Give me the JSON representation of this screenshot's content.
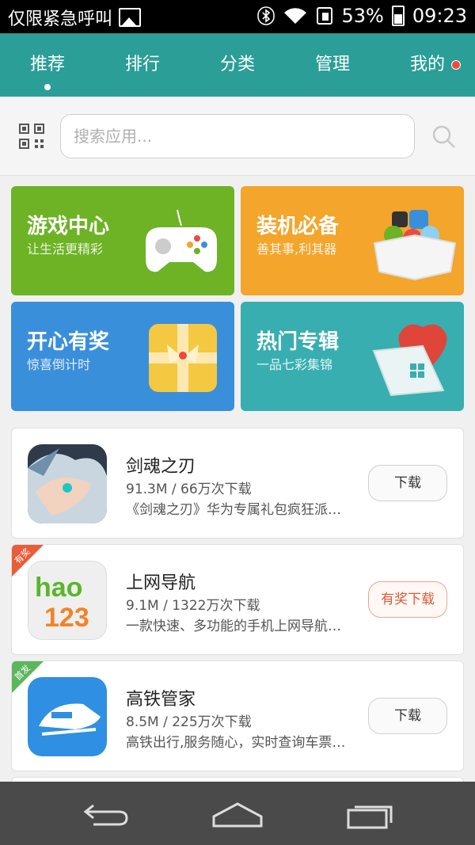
{
  "status_bar": {
    "carrier_text": "仅限紧急呼叫",
    "battery": "53%",
    "time": "09:23"
  },
  "tabs": [
    {
      "label": "推荐",
      "active": true
    },
    {
      "label": "排行"
    },
    {
      "label": "分类"
    },
    {
      "label": "管理"
    },
    {
      "label": "我的"
    }
  ],
  "search": {
    "placeholder": "搜索应用..."
  },
  "categories": [
    {
      "title": "游戏中心",
      "subtitle": "让生活更精彩",
      "color": "#6db325"
    },
    {
      "title": "装机必备",
      "subtitle": "善其事,利其器",
      "color": "#f3a52c"
    },
    {
      "title": "开心有奖",
      "subtitle": "惊喜倒计时",
      "color": "#3a8fdb"
    },
    {
      "title": "热门专辑",
      "subtitle": "一品七彩集锦",
      "color": "#38aeb0"
    }
  ],
  "apps": [
    {
      "name": "剑魂之刃",
      "meta": "91.3M / 66万次下载",
      "desc": "《剑魂之刃》华为专属礼包疯狂派…",
      "button": "下载"
    },
    {
      "name": "上网导航",
      "meta": "9.1M / 1322万次下载",
      "desc": "一款快速、多功能的手机上网导航…",
      "button": "有奖下载",
      "badge": "有奖",
      "icon_text_top": "hao",
      "icon_text_bottom": "123"
    },
    {
      "name": "高铁管家",
      "meta": "8.5M / 225万次下载",
      "desc": "高铁出行,服务随心，实时查询车票…",
      "button": "下载",
      "badge": "首发"
    }
  ]
}
